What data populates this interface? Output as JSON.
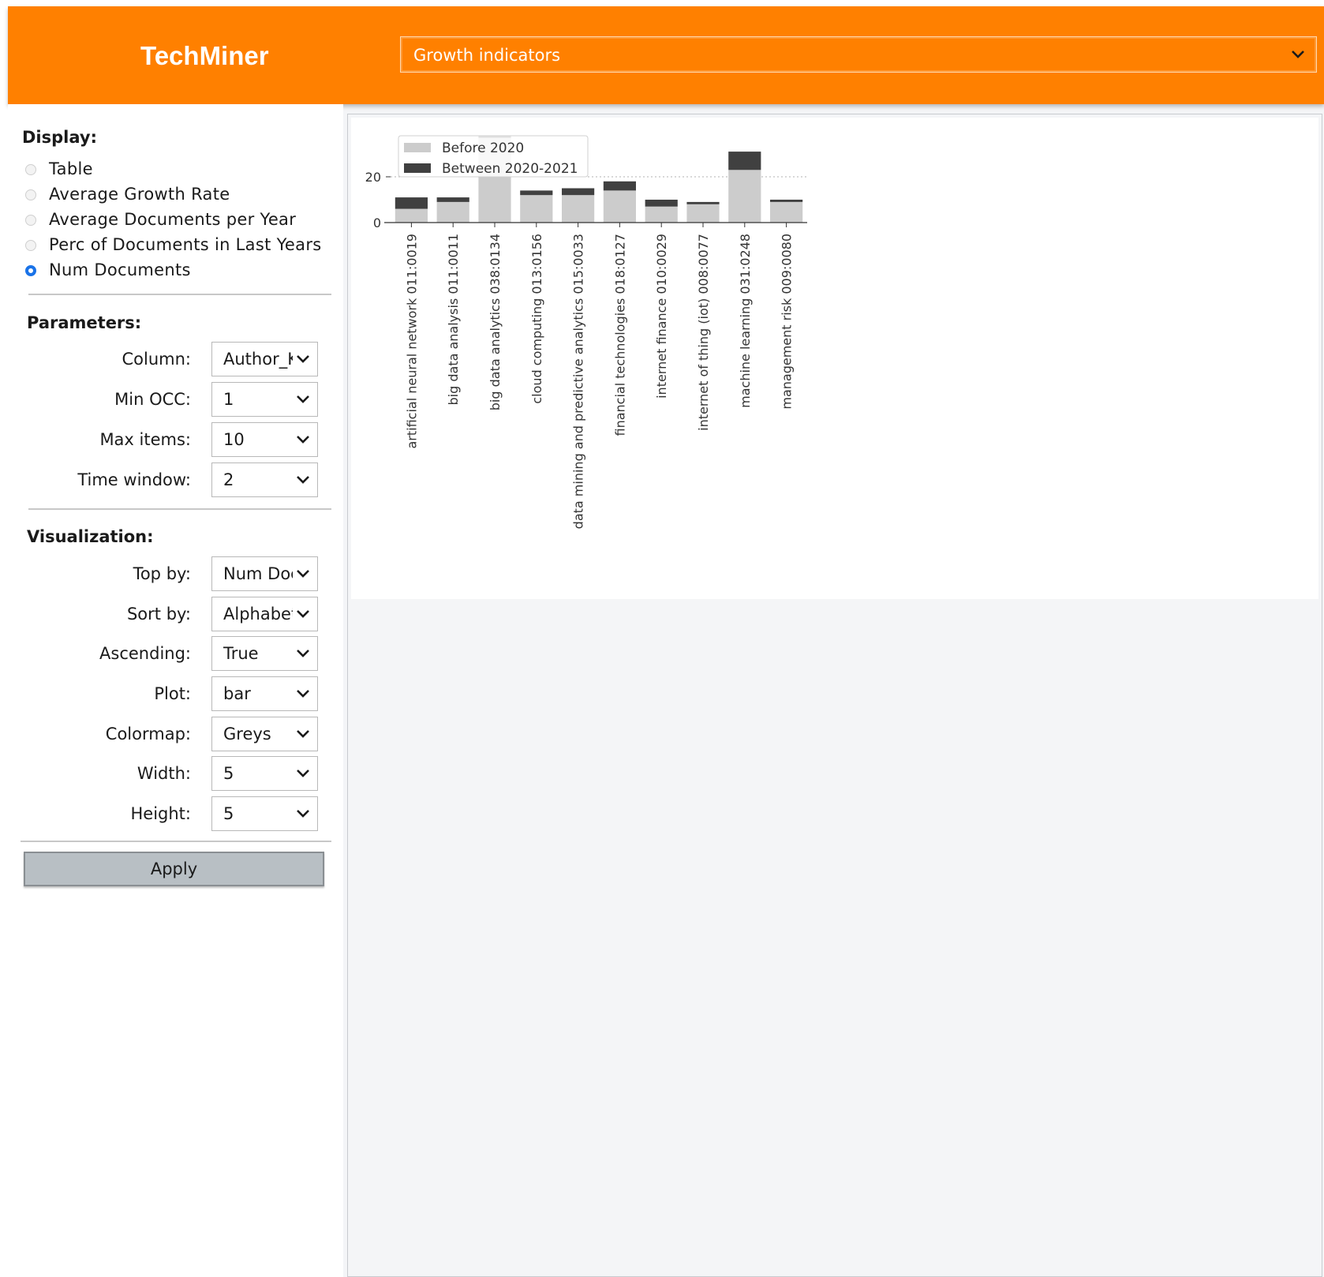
{
  "header": {
    "title": "TechMiner",
    "analysis_select": "Growth indicators"
  },
  "display": {
    "title": "Display:",
    "options": [
      {
        "label": "Table",
        "checked": false
      },
      {
        "label": "Average Growth Rate",
        "checked": false
      },
      {
        "label": "Average Documents per Year",
        "checked": false
      },
      {
        "label": "Perc of Documents in Last Years",
        "checked": false
      },
      {
        "label": "Num Documents",
        "checked": true
      }
    ]
  },
  "parameters": {
    "title": "Parameters:",
    "fields": [
      {
        "label": "Column:",
        "value": "Author_Keywords"
      },
      {
        "label": "Min OCC:",
        "value": "1"
      },
      {
        "label": "Max items:",
        "value": "10"
      },
      {
        "label": "Time window:",
        "value": "2"
      }
    ]
  },
  "visualization": {
    "title": "Visualization:",
    "fields": [
      {
        "label": "Top by:",
        "value": "Num Documents"
      },
      {
        "label": "Sort by:",
        "value": "Alphabetic"
      },
      {
        "label": "Ascending:",
        "value": "True"
      },
      {
        "label": "Plot:",
        "value": "bar"
      },
      {
        "label": "Colormap:",
        "value": "Greys"
      },
      {
        "label": "Width:",
        "value": "5"
      },
      {
        "label": "Height:",
        "value": "5"
      }
    ]
  },
  "apply_label": "Apply",
  "colors": {
    "header": "#ff8000",
    "before": "#cccccc",
    "between": "#404040",
    "radio_checked": "#1a73e8"
  },
  "chart_data": {
    "type": "bar",
    "stacked": true,
    "categories": [
      "artificial neural network 011:0019",
      "big data analysis 011:0011",
      "big data analytics 038:0134",
      "cloud computing 013:0156",
      "data mining and predictive analytics 015:0033",
      "financial technologies 018:0127",
      "internet finance 010:0029",
      "internet of thing (iot) 008:0077",
      "machine learning 031:0248",
      "management risk 009:0080"
    ],
    "series": [
      {
        "name": "Before 2020",
        "values": [
          6,
          9,
          37,
          12,
          12,
          14,
          7,
          8,
          23,
          9
        ]
      },
      {
        "name": "Between 2020-2021",
        "values": [
          5,
          2,
          1,
          2,
          3,
          4,
          3,
          1,
          8,
          1
        ]
      }
    ],
    "yticks": [
      0,
      20
    ],
    "ylim": [
      0,
      38
    ],
    "gridline_at": 20,
    "legend": "upper-left"
  }
}
